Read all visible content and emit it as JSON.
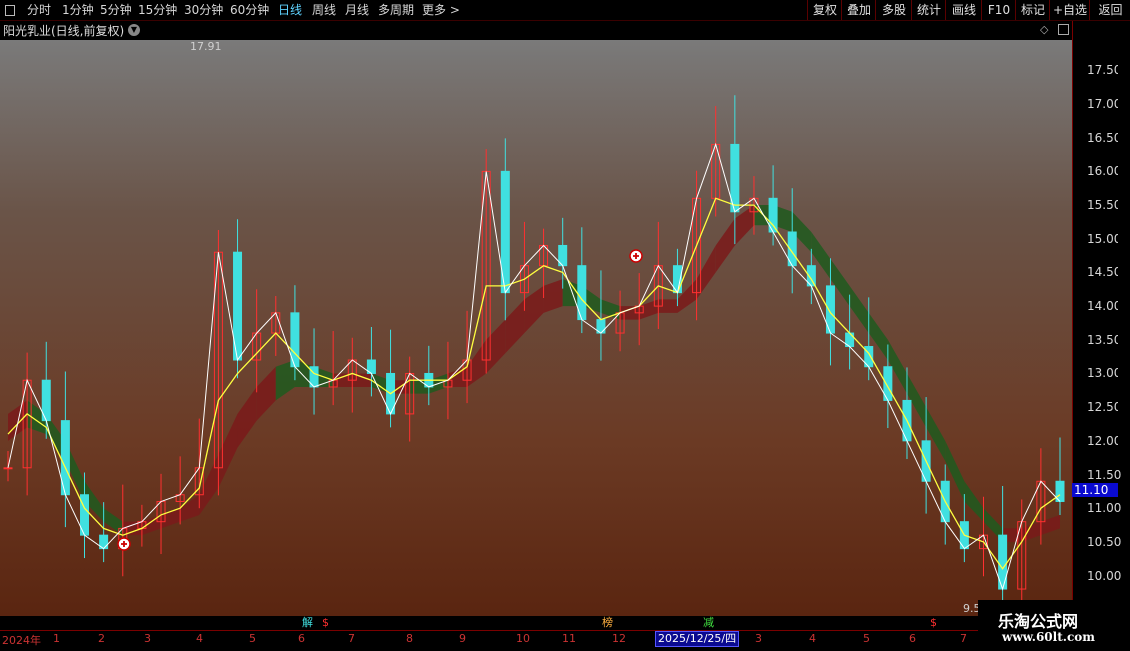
{
  "toolbar": {
    "tabs": [
      "分时",
      "1分钟",
      "5分钟",
      "15分钟",
      "30分钟",
      "60分钟",
      "日线",
      "周线",
      "月线",
      "多周期",
      "更多 >"
    ],
    "active_tab": "日线",
    "right_buttons": [
      "复权",
      "叠加",
      "多股",
      "统计",
      "画线",
      "F10",
      "标记",
      "+自选",
      "返回"
    ]
  },
  "header": {
    "title": "阳光乳业(日线,前复权)"
  },
  "colors": {
    "up": "#ff3030",
    "down": "#40e0e0",
    "ma_white": "#ffffff",
    "ma_yellow": "#ffff40",
    "band_green": "#1e5a1e",
    "band_red": "#7a1a1a",
    "band_purple": "#8a1aa0",
    "band_teal": "#108080"
  },
  "chart_data": {
    "type": "candlestick",
    "title": "阳光乳业(日线,前复权)",
    "y_ticks": [
      "17.50",
      "17.00",
      "16.50",
      "16.00",
      "15.50",
      "15.00",
      "14.50",
      "14.00",
      "13.50",
      "13.00",
      "12.50",
      "12.00",
      "11.50",
      "11.00",
      "10.50",
      "10.00"
    ],
    "ylim": [
      9.4,
      17.95
    ],
    "x_labels": [
      "2024年",
      "1",
      "2",
      "3",
      "4",
      "5",
      "6",
      "7",
      "8",
      "9",
      "10",
      "11",
      "12",
      "2025/12/25/四",
      "3",
      "4",
      "5",
      "6",
      "7"
    ],
    "current_price": "11.10",
    "annotations": {
      "max_label": "17.91",
      "min_label": "9.5"
    },
    "signals": [
      {
        "label": "解",
        "color": "#40e0e0"
      },
      {
        "label": "$",
        "color": "#ff3030"
      },
      {
        "label": "榜",
        "color": "#ffb040"
      },
      {
        "label": "减",
        "color": "#40e040"
      },
      {
        "label": "$",
        "color": "#ff3030"
      }
    ],
    "close_series": [
      11.6,
      12.9,
      12.3,
      11.2,
      10.6,
      10.4,
      10.7,
      10.8,
      11.1,
      11.2,
      11.6,
      14.8,
      13.2,
      13.6,
      13.9,
      13.1,
      12.8,
      12.9,
      13.2,
      13.0,
      12.4,
      13.0,
      12.8,
      12.9,
      13.2,
      16.0,
      14.2,
      14.6,
      14.9,
      14.6,
      13.8,
      13.6,
      13.9,
      14.0,
      14.6,
      14.2,
      15.6,
      16.4,
      15.4,
      15.6,
      15.1,
      14.6,
      14.3,
      13.6,
      13.4,
      13.1,
      12.6,
      12.0,
      11.4,
      10.8,
      10.4,
      10.6,
      9.8,
      10.8,
      11.4,
      11.1
    ],
    "yellow_ma": [
      12.1,
      12.4,
      12.2,
      11.6,
      11.0,
      10.7,
      10.6,
      10.7,
      10.9,
      11.0,
      11.3,
      12.6,
      13.0,
      13.3,
      13.6,
      13.3,
      13.0,
      12.9,
      13.0,
      12.9,
      12.7,
      12.9,
      12.9,
      12.9,
      13.1,
      14.3,
      14.3,
      14.4,
      14.6,
      14.5,
      14.1,
      13.8,
      13.9,
      14.0,
      14.3,
      14.2,
      14.9,
      15.6,
      15.5,
      15.5,
      15.2,
      14.8,
      14.4,
      13.9,
      13.6,
      13.3,
      12.8,
      12.3,
      11.7,
      11.1,
      10.6,
      10.5,
      10.1,
      10.5,
      11.0,
      11.2
    ],
    "band_upper": [
      12.4,
      12.6,
      12.4,
      12.0,
      11.4,
      11.0,
      10.8,
      10.8,
      10.9,
      11.0,
      11.2,
      11.8,
      12.4,
      12.8,
      13.1,
      13.2,
      13.1,
      13.0,
      13.0,
      13.0,
      12.9,
      12.9,
      12.9,
      13.0,
      13.1,
      13.5,
      13.8,
      14.1,
      14.3,
      14.4,
      14.3,
      14.1,
      14.0,
      14.0,
      14.1,
      14.1,
      14.4,
      14.9,
      15.3,
      15.5,
      15.5,
      15.4,
      15.1,
      14.7,
      14.3,
      13.9,
      13.5,
      13.0,
      12.5,
      12.0,
      11.4,
      11.0,
      10.7,
      10.7,
      10.8,
      10.9
    ],
    "band_lower": [
      12.0,
      12.2,
      12.1,
      11.7,
      11.1,
      10.8,
      10.6,
      10.6,
      10.7,
      10.8,
      10.9,
      11.3,
      11.9,
      12.3,
      12.6,
      12.8,
      12.8,
      12.8,
      12.8,
      12.8,
      12.7,
      12.7,
      12.7,
      12.8,
      12.8,
      13.0,
      13.3,
      13.6,
      13.9,
      14.0,
      14.0,
      13.9,
      13.8,
      13.8,
      13.9,
      13.9,
      14.1,
      14.5,
      14.9,
      15.2,
      15.2,
      15.1,
      14.8,
      14.4,
      14.0,
      13.6,
      13.2,
      12.7,
      12.2,
      11.7,
      11.1,
      10.8,
      10.5,
      10.5,
      10.6,
      10.7
    ]
  },
  "watermark": {
    "line1": "乐淘公式网",
    "line2": "www.60lt.com"
  }
}
